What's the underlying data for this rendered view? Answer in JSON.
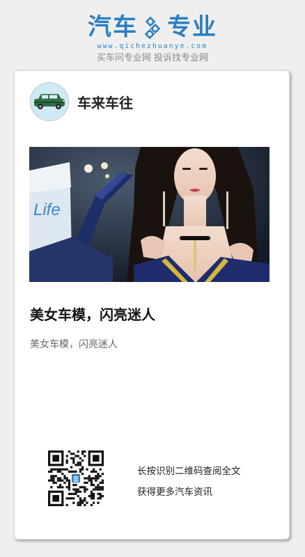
{
  "brand": {
    "word_left": "汽车",
    "word_right": "专业",
    "url": "www.qichezhuanye.com",
    "slogan": "买车问专业网 投诉找专业网"
  },
  "article": {
    "author_name": "车来车往",
    "photo_sign_text": "Life",
    "title": "美女车模，闪亮迷人",
    "summary": "美女车模，闪亮迷人"
  },
  "qr": {
    "line1": "长按识别二维码查阅全文",
    "line2": "获得更多汽车资讯"
  },
  "colors": {
    "brand_blue": "#2a7fc1",
    "page_bg": "#efefef",
    "card_bg": "#ffffff"
  }
}
